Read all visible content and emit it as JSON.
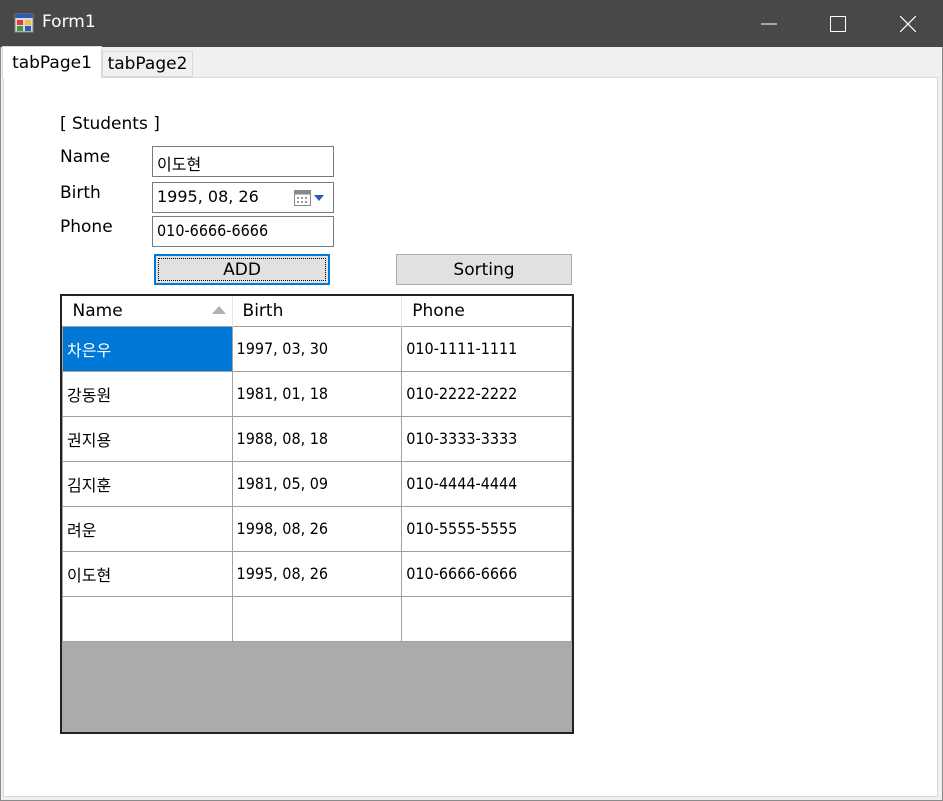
{
  "window": {
    "title": "Form1"
  },
  "tabs": [
    {
      "label": "tabPage1",
      "active": true
    },
    {
      "label": "tabPage2",
      "active": false
    }
  ],
  "form": {
    "section_title": "[ Students ]",
    "name_label": "Name",
    "birth_label": "Birth",
    "phone_label": "Phone",
    "name_value": "이도현",
    "birth_value": "1995, 08, 26",
    "phone_value": "010-6666-6666",
    "add_label": "ADD",
    "sort_label": "Sorting"
  },
  "grid": {
    "columns": [
      "Name",
      "Birth",
      "Phone"
    ],
    "sorted_column": "Name",
    "rows": [
      [
        "차은우",
        "1997, 03, 30",
        "010-1111-1111"
      ],
      [
        "강동원",
        "1981, 01, 18",
        "010-2222-2222"
      ],
      [
        "권지용",
        "1988, 08, 18",
        "010-3333-3333"
      ],
      [
        "김지훈",
        "1981, 05, 09",
        "010-4444-4444"
      ],
      [
        "려운",
        "1998, 08, 26",
        "010-5555-5555"
      ],
      [
        "이도현",
        "1995, 08, 26",
        "010-6666-6666"
      ]
    ],
    "selected_cell": "차은우"
  },
  "colors": {
    "titlebar": "#484848",
    "selection": "#0078d7",
    "grid_background": "#ababab"
  },
  "icons": [
    "app-icon",
    "minimize-icon",
    "maximize-icon",
    "close-icon",
    "calendar-icon",
    "dropdown-arrow-icon",
    "sort-ascending-icon"
  ]
}
